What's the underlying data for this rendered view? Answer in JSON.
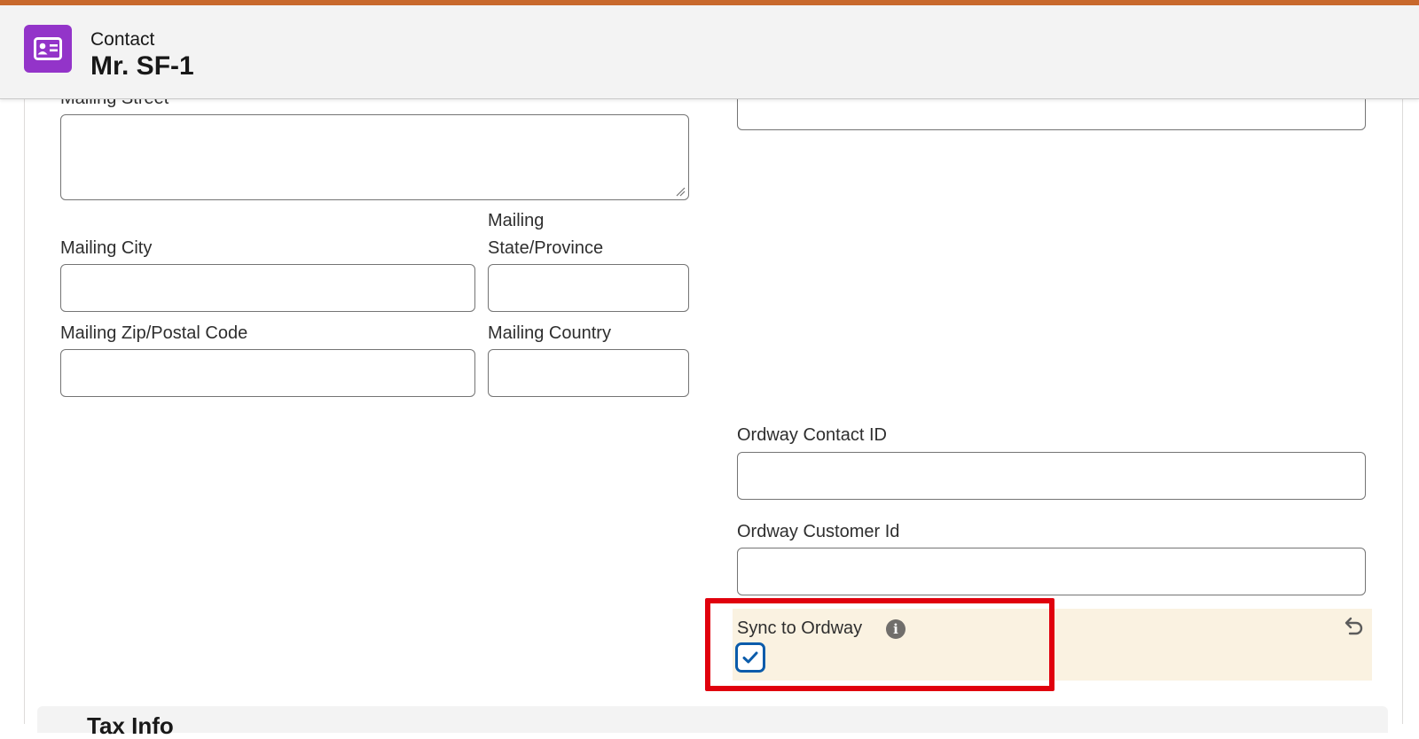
{
  "header": {
    "object_type": "Contact",
    "record_name": "Mr. SF-1",
    "icon": "contact-card-icon",
    "icon_color": "#9334c9",
    "accent_line_color": "#c8682c"
  },
  "form": {
    "mailing_street_label": "Mailing Street",
    "mailing_city_label": "Mailing City",
    "mailing_state_label_line1": "Mailing",
    "mailing_state_label_line2": "State/Province",
    "mailing_zip_label": "Mailing Zip/Postal Code",
    "mailing_country_label": "Mailing Country",
    "ordway_contact_id_label": "Ordway Contact ID",
    "ordway_customer_id_label": "Ordway Customer Id",
    "sync_to_ordway_label": "Sync to Ordway",
    "sync_to_ordway_checked": true,
    "mailing_street_value": "",
    "mailing_city_value": "",
    "mailing_state_value": "",
    "mailing_zip_value": "",
    "mailing_country_value": "",
    "ordway_contact_id_value": "",
    "ordway_customer_id_value": ""
  },
  "next_section": {
    "title": "Tax Info"
  },
  "colors": {
    "changed_field_bg": "#faf2e1",
    "checkbox_border": "#0b5cab",
    "annotation_box": "#e0000d"
  }
}
